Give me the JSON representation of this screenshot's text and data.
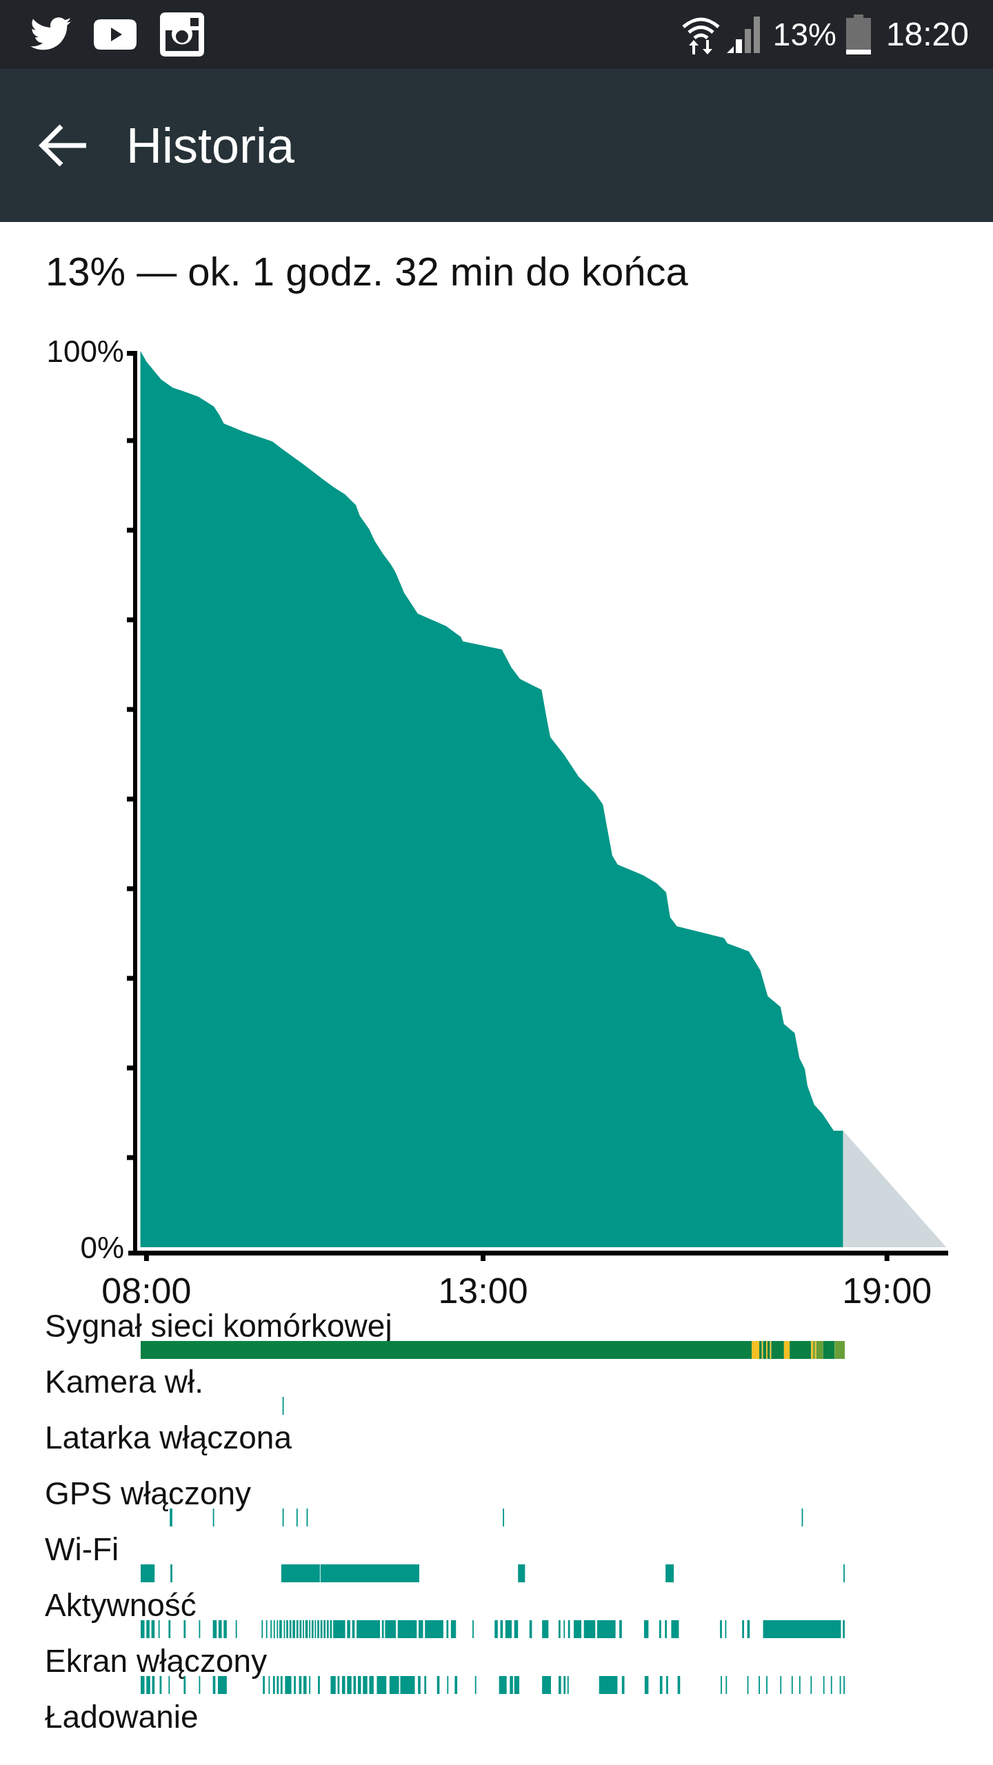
{
  "status_bar": {
    "battery": "13%",
    "time": "18:20"
  },
  "app_bar": {
    "title": "Historia"
  },
  "summary": "13% — ok. 1 godz. 32 min do końca",
  "battery_chart": {
    "chart_data": {
      "type": "area",
      "x": [
        7.91,
        8.0,
        8.22,
        8.39,
        8.55,
        8.77,
        9.0,
        9.08,
        9.15,
        9.44,
        9.87,
        10.01,
        10.34,
        10.62,
        10.78,
        10.95,
        11.11,
        11.17,
        11.31,
        11.39,
        11.51,
        11.63,
        11.7,
        11.83,
        12.03,
        12.45,
        12.67,
        12.7,
        13.28,
        13.42,
        13.55,
        13.87,
        13.95,
        14.0,
        14.2,
        14.42,
        14.67,
        14.78,
        14.92,
        15.0,
        15.38,
        15.58,
        15.72,
        15.78,
        15.88,
        16.58,
        16.63,
        16.95,
        17.12,
        17.23,
        17.42,
        17.47,
        17.63,
        17.7,
        17.78,
        17.82,
        17.92,
        18.04,
        18.21,
        18.35,
        19.88
      ],
      "series": [
        {
          "color": "#009688",
          "values": [
            100,
            98.8,
            96.8,
            95.9,
            95.5,
            94.9,
            93.8,
            92.9,
            91.9,
            91.0,
            89.9,
            89.1,
            87.3,
            85.7,
            84.8,
            84.0,
            82.8,
            81.6,
            80.1,
            78.8,
            77.4,
            76.2,
            75.3,
            73.0,
            70.7,
            69.3,
            68.1,
            67.6,
            66.7,
            64.7,
            63.4,
            62.2,
            58.8,
            56.9,
            55.0,
            52.5,
            50.6,
            49.4,
            43.7,
            42.7,
            41.5,
            40.6,
            39.6,
            36.8,
            35.8,
            34.5,
            33.9,
            33.0,
            30.9,
            28.0,
            26.8,
            24.9,
            23.9,
            21.1,
            19.9,
            18.0,
            15.9,
            14.9,
            13.0,
            13.0,
            null
          ]
        },
        {
          "color": "#cfd8dc",
          "values": [
            null,
            null,
            null,
            null,
            null,
            null,
            null,
            null,
            null,
            null,
            null,
            null,
            null,
            null,
            null,
            null,
            null,
            null,
            null,
            null,
            null,
            null,
            null,
            null,
            null,
            null,
            null,
            null,
            null,
            null,
            null,
            null,
            null,
            null,
            null,
            null,
            null,
            null,
            null,
            null,
            null,
            null,
            null,
            null,
            null,
            null,
            null,
            null,
            null,
            null,
            null,
            null,
            null,
            null,
            null,
            null,
            null,
            null,
            null,
            13.0,
            0
          ]
        }
      ],
      "xlim": [
        7.73,
        19.91
      ],
      "ylim": [
        -0.92,
        100
      ],
      "xticks": [
        {
          "value": 8,
          "label": "08:00"
        },
        {
          "value": 13,
          "label": "13:00"
        },
        {
          "value": 19,
          "label": "19:00"
        }
      ],
      "yticks": [
        {
          "value": 0,
          "label": "0%"
        },
        {
          "value": 100,
          "label": "100%"
        }
      ]
    }
  },
  "timelines": [
    {
      "label": "Sygnał sieci komórkowej"
    },
    {
      "label": "Kamera wł."
    },
    {
      "label": "Latarka włączona"
    },
    {
      "label": "GPS włączony"
    },
    {
      "label": "Wi-Fi"
    },
    {
      "label": "Aktywność"
    },
    {
      "label": "Ekran włączony"
    },
    {
      "label": "Ładowanie"
    }
  ]
}
